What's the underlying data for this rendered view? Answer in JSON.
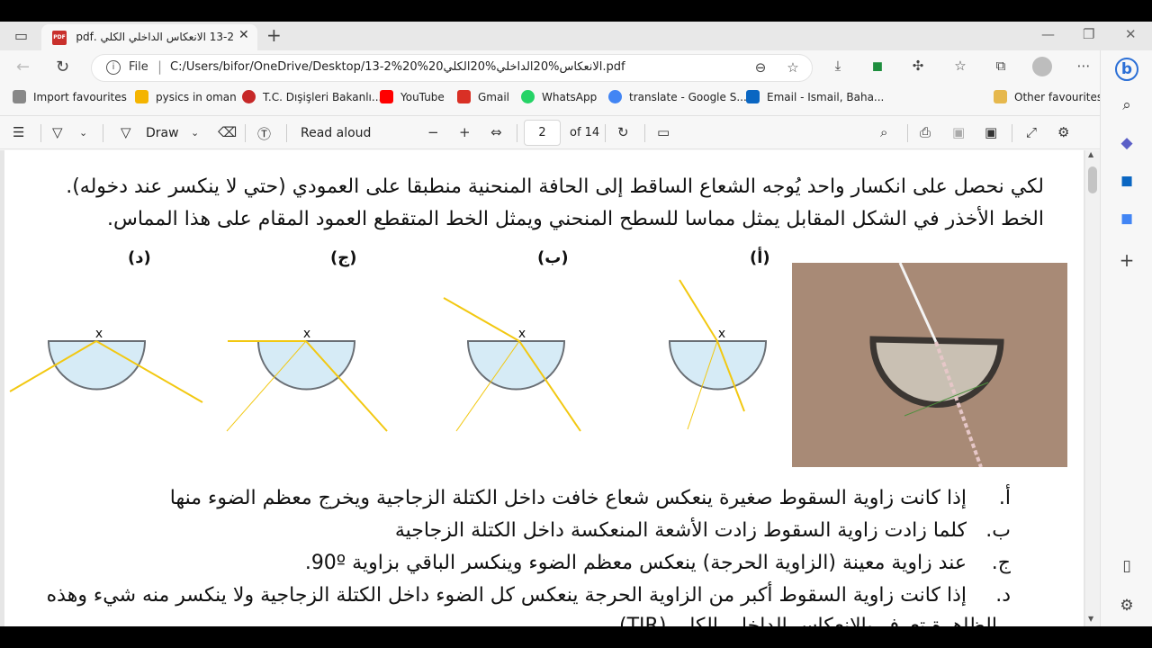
{
  "tab": {
    "title": "13-2 الانعكاس الداخلي الكلي .pdf",
    "close": "✕",
    "new": "+"
  },
  "window": {
    "minimize": "—",
    "restore": "❐",
    "close": "✕"
  },
  "address": {
    "scheme": "File",
    "separator": "|",
    "url": "C:/Users/bifor/OneDrive/Desktop/13-2%20%20الانعكاس%20الداخلي%20الكلي.pdf"
  },
  "bookmarks": [
    {
      "label": "Import favourites",
      "color": "#666666"
    },
    {
      "label": "pysics in oman",
      "color": "#f4b400"
    },
    {
      "label": "T.C. Dışişleri Bakanlı...",
      "color": "#c62828"
    },
    {
      "label": "YouTube",
      "color": "#ff0000"
    },
    {
      "label": "Gmail",
      "color": "#d93025"
    },
    {
      "label": "WhatsApp",
      "color": "#25d366"
    },
    {
      "label": "translate - Google S...",
      "color": "#4285f4"
    },
    {
      "label": "Email - Ismail, Baha...",
      "color": "#0a66c2"
    },
    {
      "label": "Other favourites",
      "color": "#e6b84d"
    }
  ],
  "toolbar": {
    "draw": "Draw",
    "read_aloud": "Read aloud",
    "page_current": "2",
    "page_total": "of 14"
  },
  "document": {
    "paragraph_line1": "لكي نحصل على انكسار واحد يُوجه الشعاع الساقط إلى الحافة المنحنية منطبقا على العمودي (حتي لا ينكسر عند دخوله).",
    "paragraph_line2": "الخط الأخذر في الشكل المقابل يمثل مماسا للسطح المنحني ويمثل الخط المتقطع العمود المقام على هذا المماس.",
    "diagrams": [
      {
        "label": "(أ)",
        "x_mark": "x"
      },
      {
        "label": "(ب)",
        "x_mark": "x"
      },
      {
        "label": "(ج)",
        "x_mark": "x"
      },
      {
        "label": "(د)",
        "x_mark": "x"
      }
    ],
    "list": [
      {
        "marker": "أ.",
        "text": "إذا كانت زاوية السقوط صغيرة ينعكس شعاع خافت داخل الكتلة الزجاجية ويخرج معظم الضوء منها"
      },
      {
        "marker": "ب.",
        "text": "كلما زادت زاوية السقوط زادت الأشعة المنعكسة داخل الكتلة الزجاجية"
      },
      {
        "marker": "ج.",
        "text": "عند زاوية معينة (الزاوية الحرجة) ينعكس معظم الضوء وينكسر الباقي بزاوية 90º."
      },
      {
        "marker": "د.",
        "text": "إذا كانت زاوية السقوط أكبر من الزاوية الحرجة ينعكس كل الضوء داخل الكتلة الزجاجية ولا ينكسر منه شيء وهذه"
      }
    ],
    "list_last_line": "الظاهرة تعرف بالانعكاس الداخلي الكلي (TIR)"
  },
  "colors": {
    "ray": "#f2c811",
    "glass": "#d6ebf6",
    "glass_edge": "#6a6f75"
  }
}
